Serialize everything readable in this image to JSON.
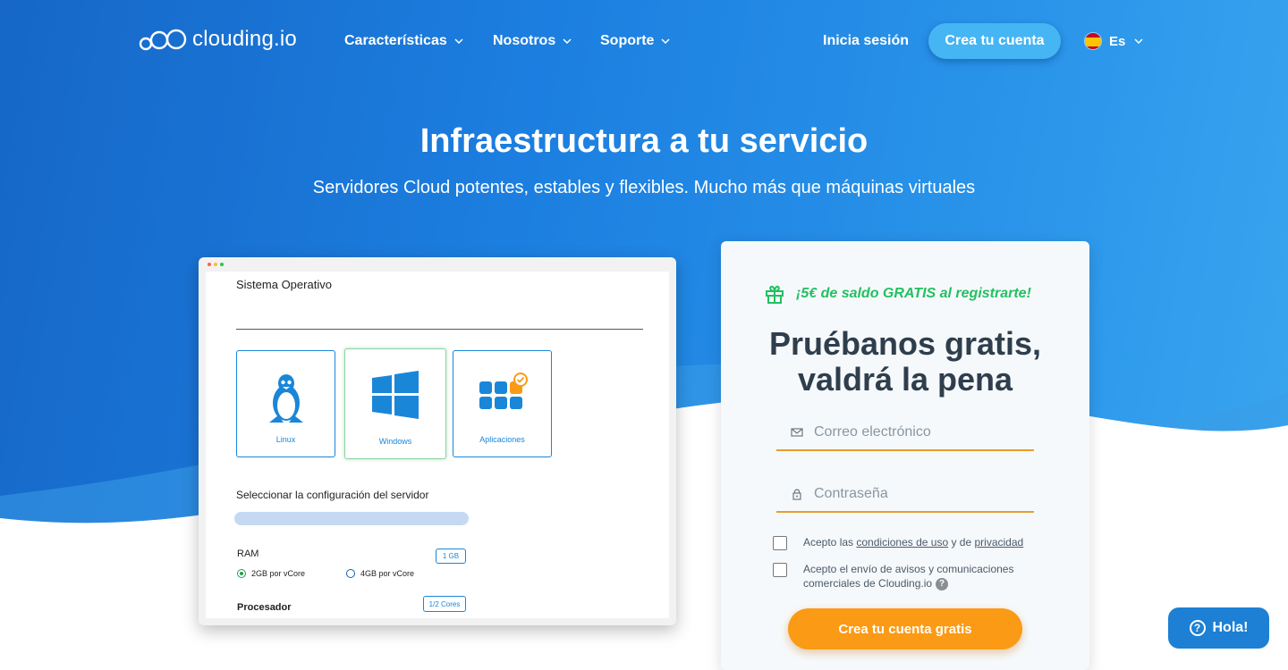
{
  "colors": {
    "hero_gradient_start": "#1667c7",
    "hero_gradient_end": "#3aa6ef",
    "accent_orange": "#fb9a14",
    "promo_green": "#22c062",
    "signup_button": "#45b5f3",
    "title_dark": "#2f3e4d",
    "link_blue": "#1a86d8"
  },
  "nav": {
    "logo_text": "clouding.io",
    "logo_icon": "cloud-circles-icon",
    "items": [
      {
        "label": "Características",
        "icon": "chevron-down-icon"
      },
      {
        "label": "Nosotros",
        "icon": "chevron-down-icon"
      },
      {
        "label": "Soporte",
        "icon": "chevron-down-icon"
      }
    ],
    "login_label": "Inicia sesión",
    "signup_label": "Crea tu cuenta",
    "language": {
      "label": "Es",
      "icon": "spain-flag-icon"
    }
  },
  "hero": {
    "title": "Infraestructura a tu servicio",
    "subtitle": "Servidores Cloud potentes, estables y flexibles. Mucho más que máquinas virtuales"
  },
  "mock": {
    "os_label": "Sistema Operativo",
    "os_options": [
      {
        "label": "Linux",
        "icon": "linux-penguin-icon",
        "selected": false
      },
      {
        "label": "Windows",
        "icon": "windows-logo-icon",
        "selected": true
      },
      {
        "label": "Aplicaciones",
        "icon": "apps-grid-icon",
        "selected": false
      }
    ],
    "config_label": "Seleccionar la configuración del servidor",
    "ram_label": "RAM",
    "ram_value": "1 GB",
    "ram_options": [
      {
        "label": "2GB por vCore",
        "selected": true
      },
      {
        "label": "4GB por vCore",
        "selected": false
      }
    ],
    "processor_label": "Procesador",
    "processor_value": "1/2 Cores"
  },
  "signup": {
    "promo": "¡5€ de saldo GRATIS al registrarte!",
    "promo_icon": "gift-icon",
    "title_line1": "Pruébanos gratis,",
    "title_line2": "valdrá la pena",
    "email_placeholder": "Correo electrónico",
    "password_placeholder": "Contraseña",
    "terms_prefix": "Acepto las ",
    "terms_link1": "condiciones de uso",
    "terms_mid": " y de ",
    "terms_link2": "privacidad",
    "comms_line1": "Acepto el envío de avisos y comunicaciones",
    "comms_line2": "comerciales de Clouding.io",
    "submit_label": "Crea tu cuenta gratis"
  },
  "chat": {
    "label": "Hola!",
    "icon": "question-circle-icon"
  }
}
